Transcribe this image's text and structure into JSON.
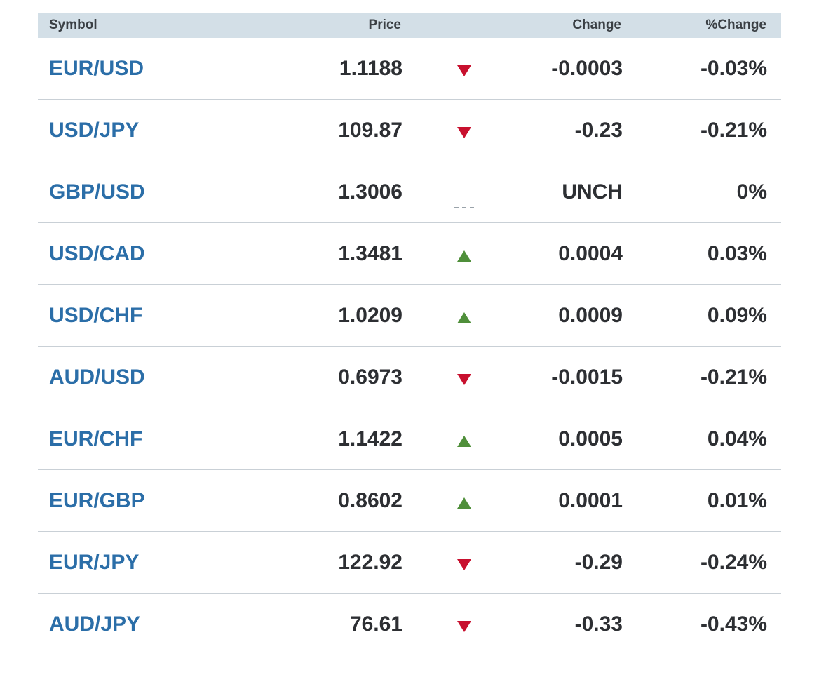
{
  "header": {
    "symbol": "Symbol",
    "price": "Price",
    "change": "Change",
    "pct_change": "%Change"
  },
  "colors": {
    "header_bg": "#d3dfe7",
    "symbol_link": "#2b6ea8",
    "down": "#c8102e",
    "up": "#4f8f3a",
    "text": "#2d2f33"
  },
  "rows": [
    {
      "symbol": "EUR/USD",
      "price": "1.1188",
      "direction": "down",
      "direction_icon": "down-arrow-icon",
      "change": "-0.0003",
      "pct": "-0.03%"
    },
    {
      "symbol": "USD/JPY",
      "price": "109.87",
      "direction": "down",
      "direction_icon": "down-arrow-icon",
      "change": "-0.23",
      "pct": "-0.21%"
    },
    {
      "symbol": "GBP/USD",
      "price": "1.3006",
      "direction": "unch",
      "direction_icon": "unchanged-dash-icon",
      "change": "UNCH",
      "pct": "0%"
    },
    {
      "symbol": "USD/CAD",
      "price": "1.3481",
      "direction": "up",
      "direction_icon": "up-arrow-icon",
      "change": "0.0004",
      "pct": "0.03%"
    },
    {
      "symbol": "USD/CHF",
      "price": "1.0209",
      "direction": "up",
      "direction_icon": "up-arrow-icon",
      "change": "0.0009",
      "pct": "0.09%"
    },
    {
      "symbol": "AUD/USD",
      "price": "0.6973",
      "direction": "down",
      "direction_icon": "down-arrow-icon",
      "change": "-0.0015",
      "pct": "-0.21%"
    },
    {
      "symbol": "EUR/CHF",
      "price": "1.1422",
      "direction": "up",
      "direction_icon": "up-arrow-icon",
      "change": "0.0005",
      "pct": "0.04%"
    },
    {
      "symbol": "EUR/GBP",
      "price": "0.8602",
      "direction": "up",
      "direction_icon": "up-arrow-icon",
      "change": "0.0001",
      "pct": "0.01%"
    },
    {
      "symbol": "EUR/JPY",
      "price": "122.92",
      "direction": "down",
      "direction_icon": "down-arrow-icon",
      "change": "-0.29",
      "pct": "-0.24%"
    },
    {
      "symbol": "AUD/JPY",
      "price": "76.61",
      "direction": "down",
      "direction_icon": "down-arrow-icon",
      "change": "-0.33",
      "pct": "-0.43%"
    }
  ]
}
